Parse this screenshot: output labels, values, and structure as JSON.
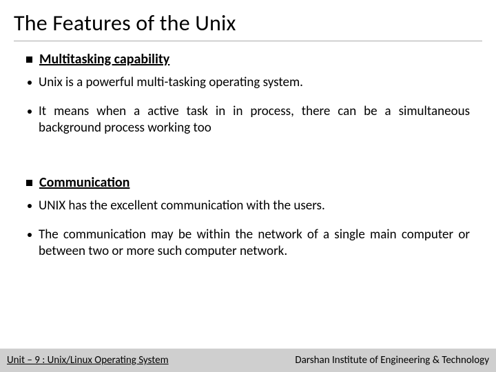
{
  "title": "The Features of the Unix",
  "sections": [
    {
      "heading": "Multitasking capability",
      "items": [
        "Unix is a powerful multi-tasking operating system.",
        "It means when a active task in in process, there can be a simultaneous background process working too"
      ]
    },
    {
      "heading": "Communication",
      "items": [
        "UNIX has the excellent communication with the users.",
        "The communication may be within the network of a single main computer or between two or more such computer network."
      ]
    }
  ],
  "footer": {
    "left": "Unit – 9  : Unix/Linux Operating System",
    "right": "Darshan Institute of Engineering & Technology"
  }
}
